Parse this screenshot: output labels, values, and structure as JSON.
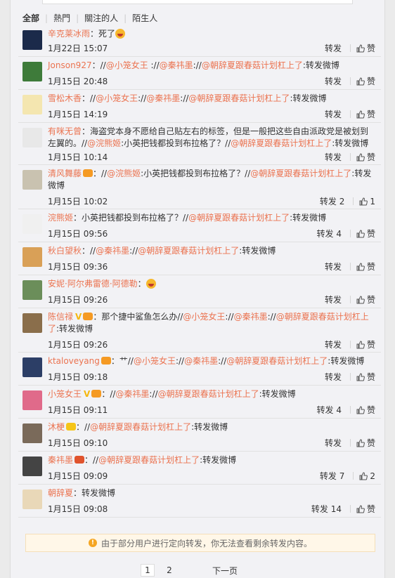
{
  "filters": [
    "全部",
    "熱門",
    "關注的人",
    "陌生人"
  ],
  "labels": {
    "forward": "转发",
    "like": "赞"
  },
  "items": [
    {
      "avatar_color": "#1b2a4a",
      "user": "辛克莱冰雨",
      "badges": "",
      "text_parts": [
        {
          "t": "：死了",
          "c": ""
        }
      ],
      "emoji": true,
      "time": "1月22日 15:07",
      "fw": "",
      "lk": ""
    },
    {
      "avatar_color": "#3e7b3a",
      "user": "Jonson927",
      "badges": "",
      "text_parts": [
        {
          "t": "：//",
          "c": ""
        },
        {
          "t": "@小笼女王",
          "c": "link"
        },
        {
          "t": " ://",
          "c": ""
        },
        {
          "t": "@秦祎墨",
          "c": "link"
        },
        {
          "t": "://",
          "c": ""
        },
        {
          "t": "@朝辞夏跟春菇计划杠上了",
          "c": "link"
        },
        {
          "t": ":转发微博",
          "c": ""
        }
      ],
      "time": "1月15日 20:48",
      "fw": "",
      "lk": ""
    },
    {
      "avatar_color": "#f4e6b0",
      "user": "雪松木香",
      "badges": "",
      "text_parts": [
        {
          "t": "：//",
          "c": ""
        },
        {
          "t": "@小笼女王",
          "c": "link"
        },
        {
          "t": "://",
          "c": ""
        },
        {
          "t": "@秦祎墨",
          "c": "link"
        },
        {
          "t": "://",
          "c": ""
        },
        {
          "t": "@朝辞夏跟春菇计划杠上了",
          "c": "link"
        },
        {
          "t": ":转发微博",
          "c": ""
        }
      ],
      "time": "1月15日 14:19",
      "fw": "",
      "lk": ""
    },
    {
      "avatar_color": "#e8e8e8",
      "user": "有咪无曾",
      "badges": "",
      "text_parts": [
        {
          "t": "：海盗党本身不愿给自己贴左右的标签，但是一般把这些自由派政党是被划到左翼的。//",
          "c": ""
        },
        {
          "t": "@浣熊姬",
          "c": "link"
        },
        {
          "t": ":小英把钱都投到布拉格了？//",
          "c": ""
        },
        {
          "t": "@朝辞夏跟春菇计划杠上了",
          "c": "link"
        },
        {
          "t": ":转发微博",
          "c": ""
        }
      ],
      "time": "1月15日 10:14",
      "fw": "",
      "lk": ""
    },
    {
      "avatar_color": "#c9c2b0",
      "user": "清风舞藤",
      "badges": "or",
      "text_parts": [
        {
          "t": "：//",
          "c": ""
        },
        {
          "t": "@浣熊姬",
          "c": "link"
        },
        {
          "t": ":小英把钱都投到布拉格了？//",
          "c": ""
        },
        {
          "t": "@朝辞夏跟春菇计划杠上了",
          "c": "link"
        },
        {
          "t": ":转发微博",
          "c": ""
        }
      ],
      "time": "1月15日 10:02",
      "fw": "2",
      "lk": "1"
    },
    {
      "avatar_color": "#f0f0f0",
      "user": "浣熊姬",
      "badges": "",
      "text_parts": [
        {
          "t": "：小英把钱都投到布拉格了？//",
          "c": ""
        },
        {
          "t": "@朝辞夏跟春菇计划杠上了",
          "c": "link"
        },
        {
          "t": ":转发微博",
          "c": ""
        }
      ],
      "time": "1月15日 09:56",
      "fw": "4",
      "lk": ""
    },
    {
      "avatar_color": "#d9a057",
      "user": "秋白望秋",
      "badges": "",
      "text_parts": [
        {
          "t": "：//",
          "c": ""
        },
        {
          "t": "@秦祎墨",
          "c": "link"
        },
        {
          "t": "://",
          "c": ""
        },
        {
          "t": "@朝辞夏跟春菇计划杠上了",
          "c": "link"
        },
        {
          "t": ":转发微博",
          "c": ""
        }
      ],
      "time": "1月15日 09:36",
      "fw": "",
      "lk": ""
    },
    {
      "avatar_color": "#6b8e5a",
      "user": "安妮·阿尔弗雷德·阿德勒",
      "badges": "",
      "text_parts": [
        {
          "t": "：",
          "c": ""
        }
      ],
      "emoji": true,
      "time": "1月15日 09:26",
      "fw": "",
      "lk": ""
    },
    {
      "avatar_color": "#8a6e4b",
      "user": "陈信禄",
      "badges": "vor",
      "text_parts": [
        {
          "t": "：那个捷中鲨鱼怎么办//",
          "c": ""
        },
        {
          "t": "@小笼女王",
          "c": "link"
        },
        {
          "t": "://",
          "c": ""
        },
        {
          "t": "@秦祎墨",
          "c": "link"
        },
        {
          "t": "://",
          "c": ""
        },
        {
          "t": "@朝辞夏跟春菇计划杠上了",
          "c": "link"
        },
        {
          "t": ":转发微博",
          "c": ""
        }
      ],
      "time": "1月15日 09:26",
      "fw": "",
      "lk": ""
    },
    {
      "avatar_color": "#2c3e66",
      "user": "ktaloveyang",
      "badges": "or",
      "text_parts": [
        {
          "t": "：艹//",
          "c": ""
        },
        {
          "t": "@小笼女王",
          "c": "link"
        },
        {
          "t": "://",
          "c": ""
        },
        {
          "t": "@秦祎墨",
          "c": "link"
        },
        {
          "t": "://",
          "c": ""
        },
        {
          "t": "@朝辞夏跟春菇计划杠上了",
          "c": "link"
        },
        {
          "t": ":转发微博",
          "c": ""
        }
      ],
      "time": "1月15日 09:18",
      "fw": "",
      "lk": ""
    },
    {
      "avatar_color": "#e06a8a",
      "user": "小笼女王",
      "badges": "vor",
      "text_parts": [
        {
          "t": "：//",
          "c": ""
        },
        {
          "t": "@秦祎墨",
          "c": "link"
        },
        {
          "t": "://",
          "c": ""
        },
        {
          "t": "@朝辞夏跟春菇计划杠上了",
          "c": "link"
        },
        {
          "t": ":转发微博",
          "c": ""
        }
      ],
      "time": "1月15日 09:11",
      "fw": "4",
      "lk": ""
    },
    {
      "avatar_color": "#7a6a5a",
      "user": "沐梗",
      "badges": "yl",
      "text_parts": [
        {
          "t": "：//",
          "c": ""
        },
        {
          "t": "@朝辞夏跟春菇计划杠上了",
          "c": "link"
        },
        {
          "t": ":转发微博",
          "c": ""
        }
      ],
      "time": "1月15日 09:10",
      "fw": "",
      "lk": ""
    },
    {
      "avatar_color": "#444444",
      "user": "秦祎墨",
      "badges": "red",
      "text_parts": [
        {
          "t": "：//",
          "c": ""
        },
        {
          "t": "@朝辞夏跟春菇计划杠上了",
          "c": "link"
        },
        {
          "t": ":转发微博",
          "c": ""
        }
      ],
      "time": "1月15日 09:09",
      "fw": "7",
      "lk": "2"
    },
    {
      "avatar_color": "#e9d8b8",
      "user": "朝辞夏",
      "badges": "",
      "text_parts": [
        {
          "t": "：转发微博",
          "c": ""
        }
      ],
      "time": "1月15日 09:08",
      "fw": "14",
      "lk": ""
    }
  ],
  "notice": "由于部分用户进行定向转发，你无法查看剩余转发内容。",
  "pager": {
    "p1": "1",
    "p2": "2",
    "next": "下一页"
  }
}
